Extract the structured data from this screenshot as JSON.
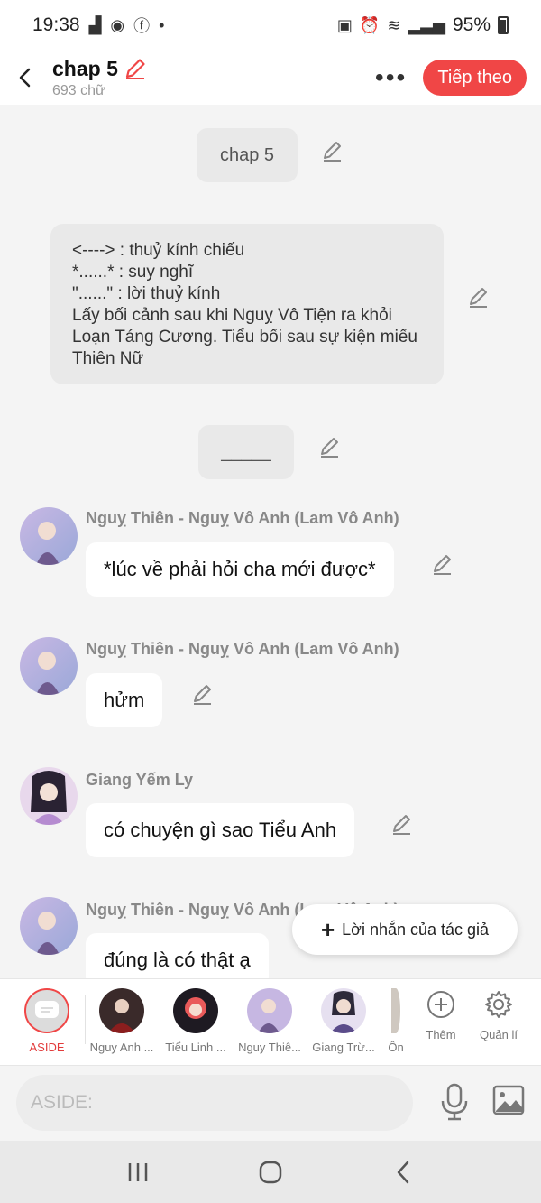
{
  "status_bar": {
    "time": "19:38",
    "battery": "95%"
  },
  "header": {
    "title": "chap 5",
    "subtitle": "693 chữ",
    "more": "•••",
    "next_label": "Tiếp theo"
  },
  "content": {
    "chapter_bubble": "chap 5",
    "note": "<----> : thuỷ kính chiếu\n*......* : suy nghĩ\n\"......\" : lời thuỷ kính\nLấy bối cảnh sau khi Nguỵ Vô Tiện ra khỏi Loạn Táng Cương. Tiểu bối sau sự kiện miếu Thiên Nữ",
    "separator": "_____",
    "messages": [
      {
        "speaker": "Nguỵ Thiên - Nguỵ Vô Anh (Lam Vô Anh)",
        "text": "*lúc về phải hỏi cha mới được*"
      },
      {
        "speaker": "Nguỵ Thiên - Nguỵ Vô Anh (Lam Vô Anh)",
        "text": "hửm"
      },
      {
        "speaker": "Giang Yếm Ly",
        "text": "có chuyện gì sao Tiểu Anh"
      },
      {
        "speaker": "Nguỵ Thiên - Nguỵ Vô Anh (Lam Vô Anh)",
        "text": "đúng là có thật ạ"
      }
    ],
    "fab_label": "Lời nhắn của tác giả"
  },
  "char_bar": {
    "aside": "ASIDE",
    "characters": [
      "Nguy Anh ...",
      "Tiểu Linh ...",
      "Nguy Thiê...",
      "Giang Trừ...",
      "Ôn"
    ],
    "add_label": "Thêm",
    "manage_label": "Quản lí"
  },
  "input": {
    "placeholder": "ASIDE:"
  },
  "colors": {
    "accent": "#f04646",
    "background": "#f4f4f4"
  }
}
